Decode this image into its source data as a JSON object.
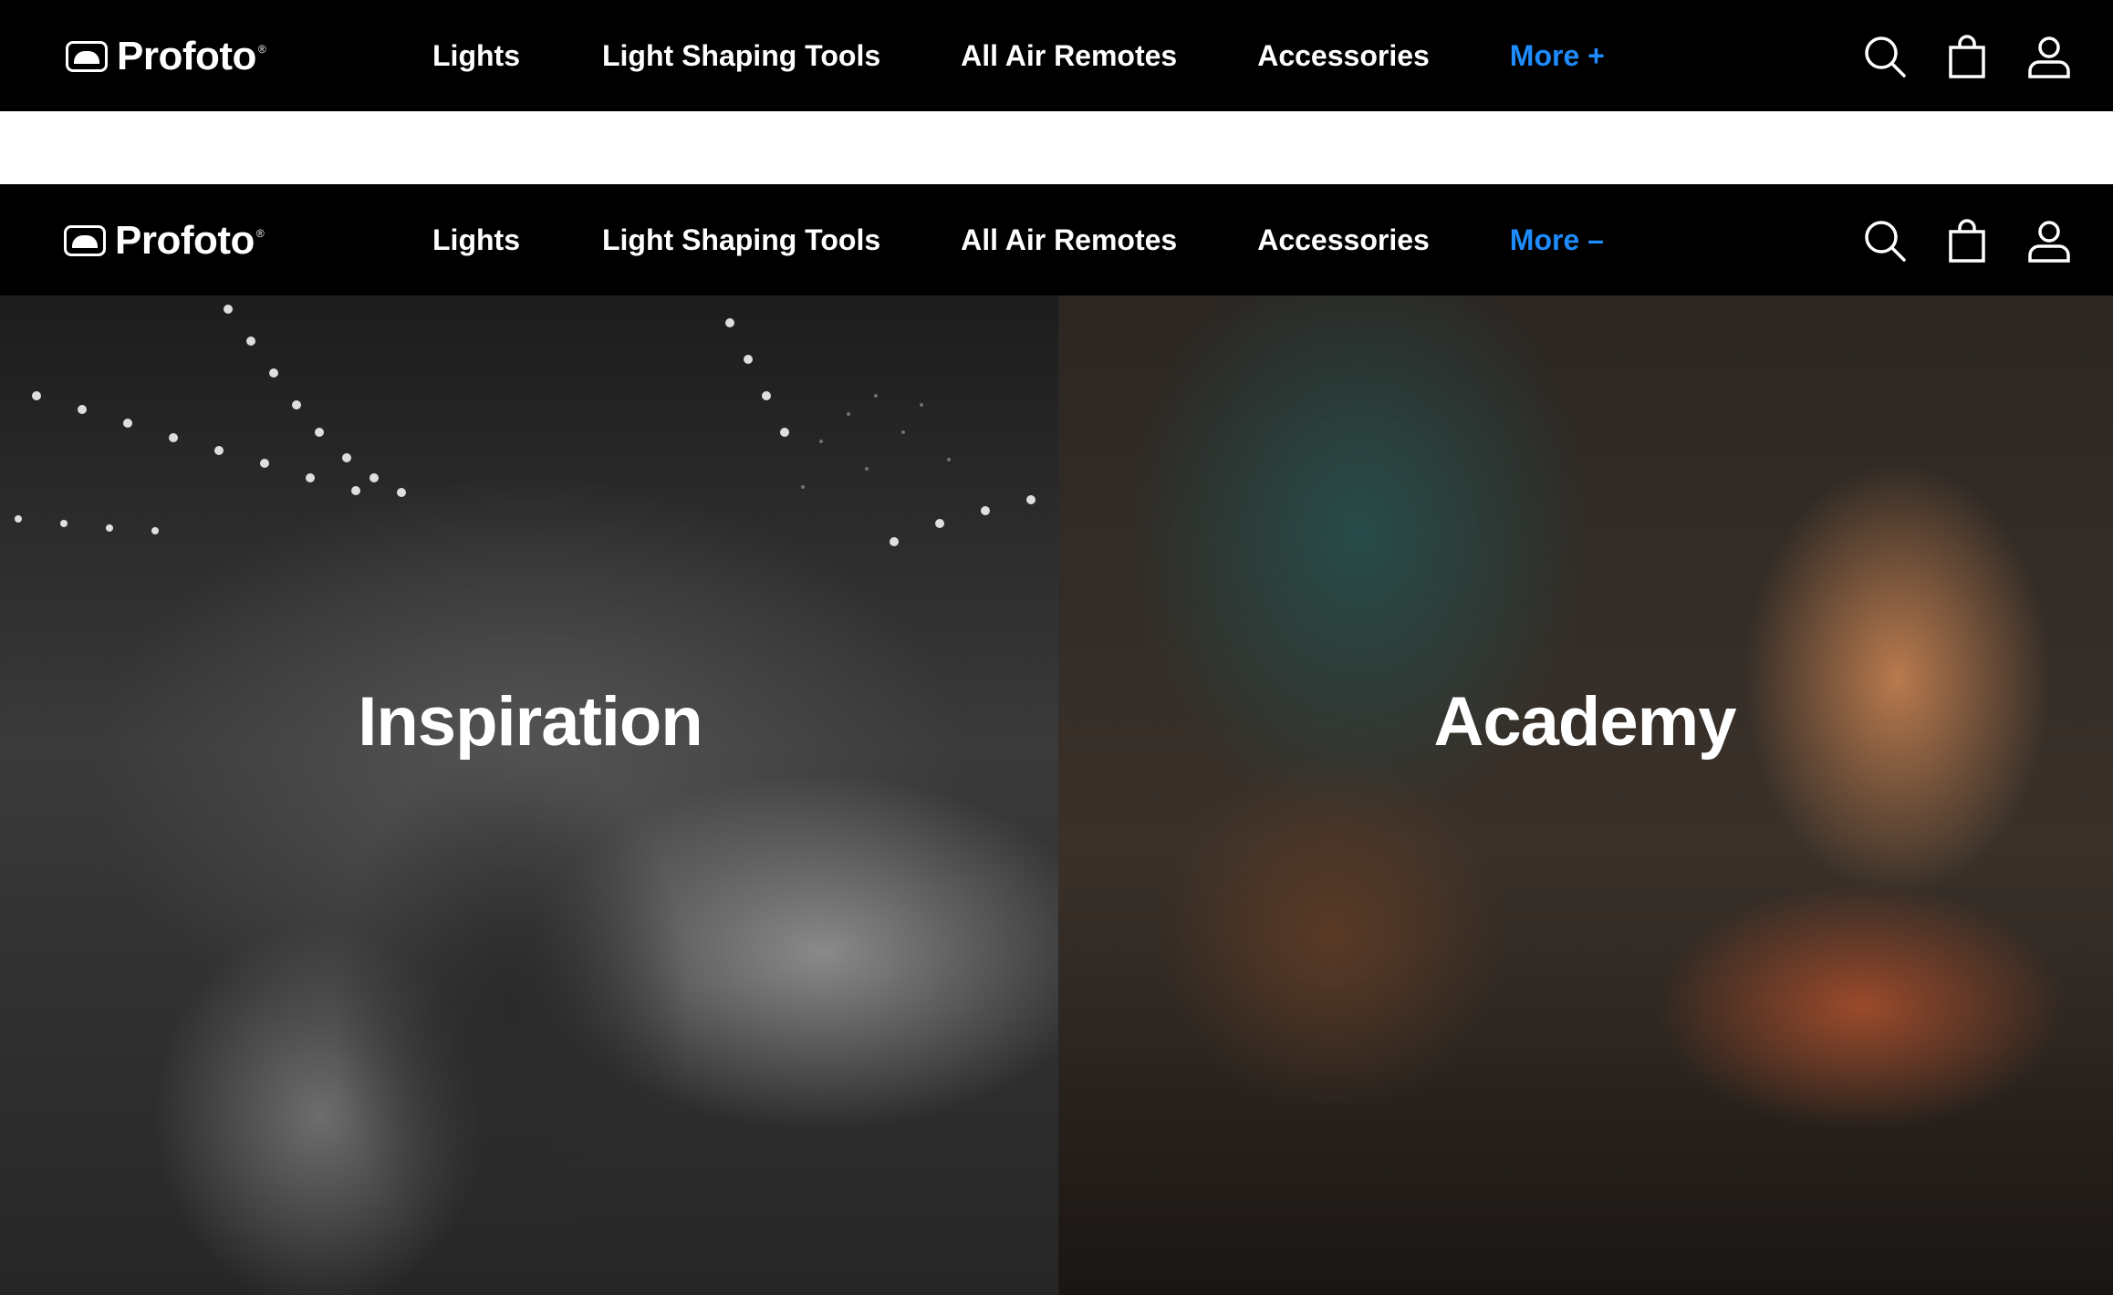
{
  "brand": {
    "name": "Profoto"
  },
  "nav_collapsed": {
    "links": [
      "Lights",
      "Light Shaping Tools",
      "All Air Remotes",
      "Accessories"
    ],
    "more_label": "More +"
  },
  "nav_expanded": {
    "links": [
      "Lights",
      "Light Shaping Tools",
      "All Air Remotes",
      "Accessories"
    ],
    "more_label": "More –"
  },
  "colors": {
    "nav_background": "#000000",
    "nav_text": "#ffffff",
    "accent": "#1e8bff"
  },
  "icons": {
    "search": "search-icon",
    "bag": "shopping-bag-icon",
    "account": "user-icon"
  },
  "tiles": [
    {
      "title": "Inspiration"
    },
    {
      "title": "Academy"
    }
  ]
}
